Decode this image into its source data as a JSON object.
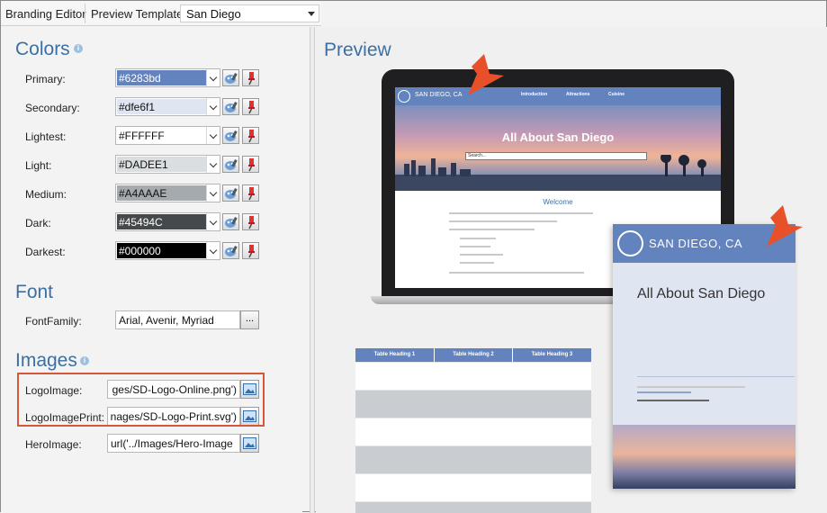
{
  "toolbar": {
    "title": "Branding Editor",
    "template_label": "Preview Template:",
    "template_value": "San Diego"
  },
  "sections": {
    "colors": "Colors",
    "font": "Font",
    "images": "Images",
    "preview": "Preview"
  },
  "colors": [
    {
      "label": "Primary:",
      "value": "#6283bd",
      "swatch": "#6283bd",
      "text_color": "#ffffff"
    },
    {
      "label": "Secondary:",
      "value": "#dfe6f1",
      "swatch": "#dfe6f1",
      "text_color": "#111111"
    },
    {
      "label": "Lightest:",
      "value": "#FFFFFF",
      "swatch": "#ffffff",
      "text_color": "#111111"
    },
    {
      "label": "Light:",
      "value": "#DADEE1",
      "swatch": "#dadee1",
      "text_color": "#111111"
    },
    {
      "label": "Medium:",
      "value": "#A4AAAE",
      "swatch": "#a4aaae",
      "text_color": "#111111"
    },
    {
      "label": "Dark:",
      "value": "#45494C",
      "swatch": "#45494c",
      "text_color": "#ffffff"
    },
    {
      "label": "Darkest:",
      "value": "#000000",
      "swatch": "#000000",
      "text_color": "#ffffff"
    }
  ],
  "font": {
    "label": "FontFamily:",
    "value": "Arial, Avenir, Myriad",
    "browse": "..."
  },
  "images": [
    {
      "label": "LogoImage:",
      "value": "ges/SD-Logo-Online.png')"
    },
    {
      "label": "LogoImagePrint:",
      "value": "nages/SD-Logo-Print.svg')"
    },
    {
      "label": "HeroImage:",
      "value": "url('../Images/Hero-Image"
    }
  ],
  "preview": {
    "site_brand": "SAN DIEGO, CA",
    "nav": [
      "Introduction",
      "Attractions",
      "Cuisine"
    ],
    "hero_title": "All About San Diego",
    "search_placeholder": "Search...",
    "welcome": "Welcome",
    "table_headings": [
      "Table Heading 1",
      "Table Heading 2",
      "Table Heading 3"
    ],
    "print_brand": "SAN DIEGO, CA",
    "print_title": "All About San Diego"
  },
  "accent_colors": {
    "section_heading": "#3c6fa3",
    "highlight_box": "#d6573a",
    "arrow": "#e8502a"
  }
}
